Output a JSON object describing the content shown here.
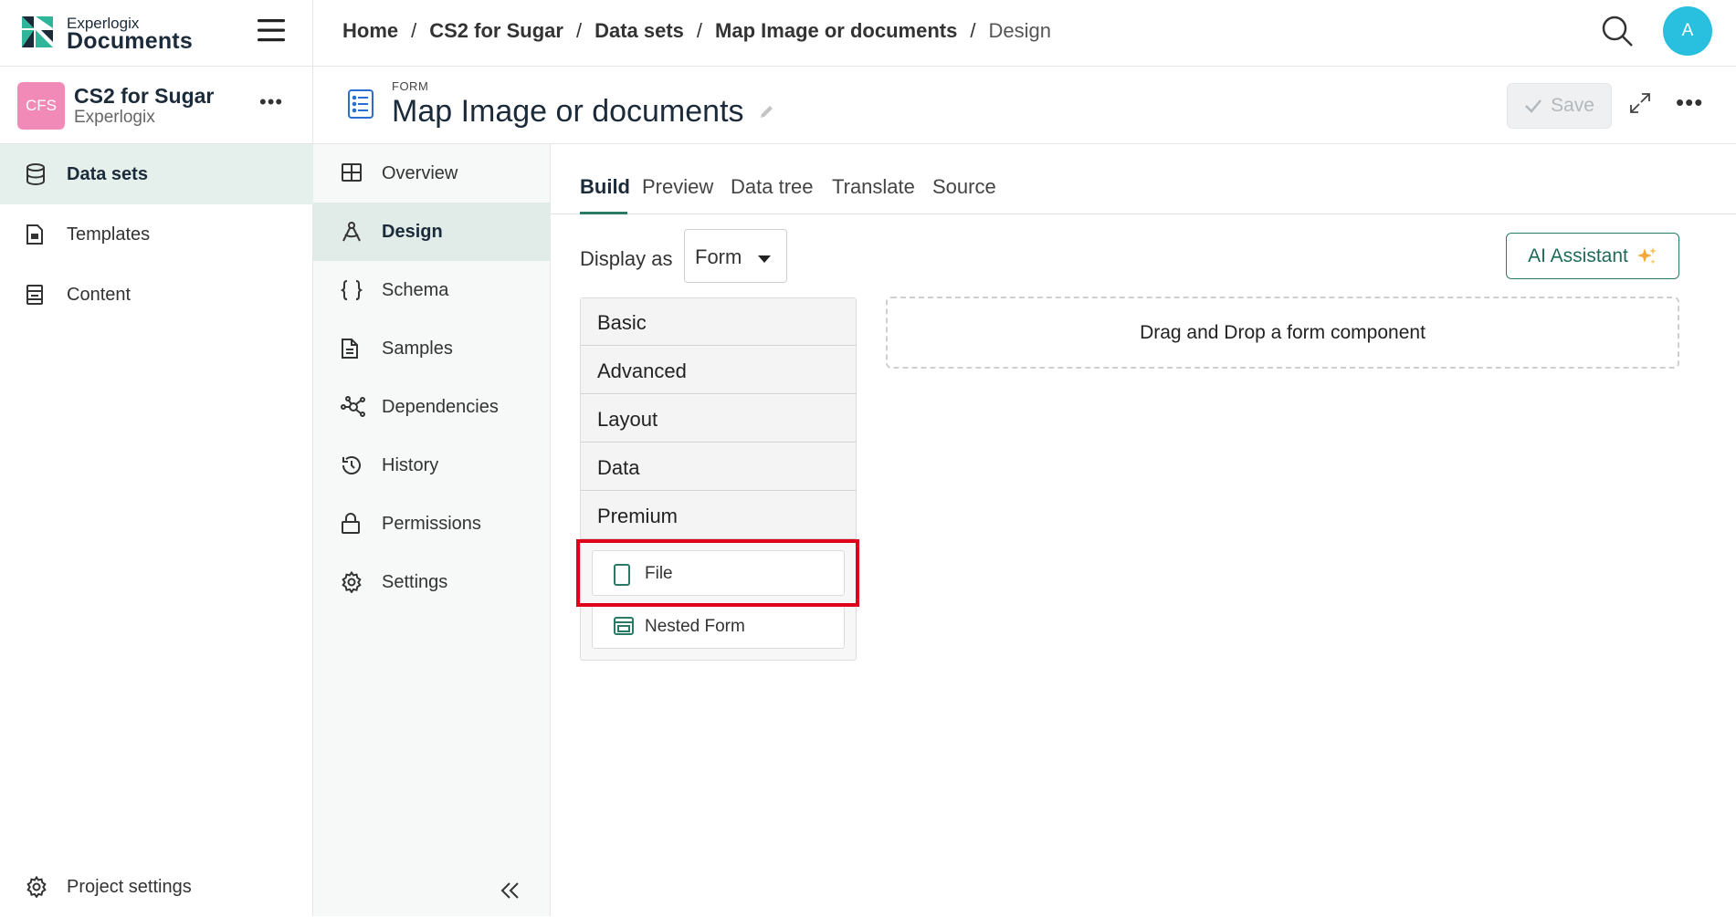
{
  "brand": {
    "top": "Experlogix",
    "name": "Documents"
  },
  "project": {
    "initials": "CFS",
    "name": "CS2 for Sugar",
    "org": "Experlogix"
  },
  "sidebar": {
    "items": [
      {
        "label": "Data sets",
        "icon": "database-icon",
        "active": true
      },
      {
        "label": "Templates",
        "icon": "template-icon",
        "active": false
      },
      {
        "label": "Content",
        "icon": "content-icon",
        "active": false
      }
    ],
    "project_settings": "Project settings"
  },
  "breadcrumb": {
    "items": [
      "Home",
      "CS2 for Sugar",
      "Data sets",
      "Map Image or documents"
    ],
    "current": "Design",
    "separator": "/"
  },
  "user": {
    "initial": "A"
  },
  "form": {
    "kicker": "FORM",
    "title": "Map Image or documents"
  },
  "actions": {
    "save": "Save"
  },
  "subnav": {
    "items": [
      {
        "label": "Overview",
        "icon": "grid-icon"
      },
      {
        "label": "Design",
        "icon": "design-icon",
        "active": true
      },
      {
        "label": "Schema",
        "icon": "braces-icon"
      },
      {
        "label": "Samples",
        "icon": "document-icon"
      },
      {
        "label": "Dependencies",
        "icon": "network-icon"
      },
      {
        "label": "History",
        "icon": "history-icon"
      },
      {
        "label": "Permissions",
        "icon": "lock-icon"
      },
      {
        "label": "Settings",
        "icon": "gear-icon"
      }
    ]
  },
  "tabs": [
    "Build",
    "Preview",
    "Data tree",
    "Translate",
    "Source"
  ],
  "active_tab": "Build",
  "display": {
    "label": "Display as",
    "value": "Form"
  },
  "ai_button": "AI Assistant",
  "palette": {
    "groups": [
      "Basic",
      "Advanced",
      "Layout",
      "Data",
      "Premium"
    ],
    "components": [
      {
        "label": "File",
        "icon": "file-icon"
      },
      {
        "label": "Nested Form",
        "icon": "nested-form-icon"
      }
    ]
  },
  "dropzone": "Drag and Drop a form component",
  "colors": {
    "accent": "#2a7a66",
    "avatar": "#29c0e0",
    "project_badge": "#f28ab8",
    "highlight": "#e0001a"
  }
}
